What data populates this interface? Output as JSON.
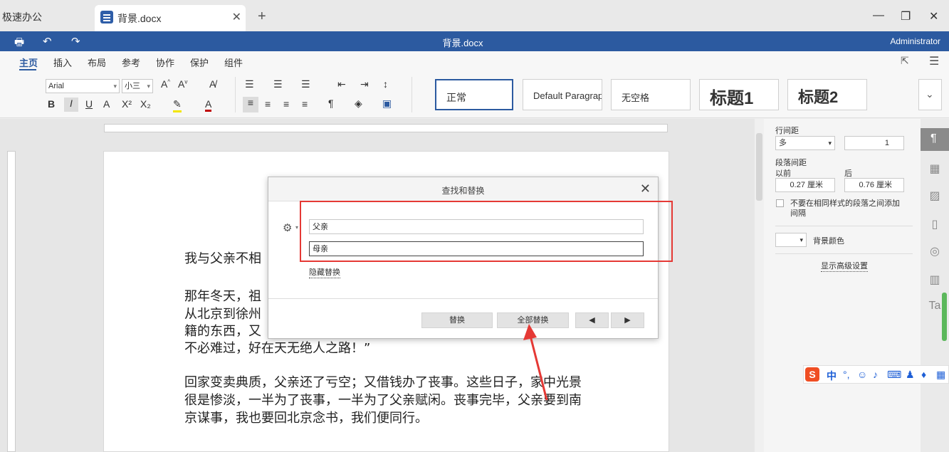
{
  "tabs": {
    "prev_tab": "极速办公",
    "active_tab": "背景.docx",
    "new_tab": "+",
    "close": "✕"
  },
  "window": {
    "minimize": "—",
    "restore": "❐",
    "close": "✕"
  },
  "titlebar": {
    "title": "背景.docx",
    "user": "Administrator"
  },
  "menu": {
    "items": [
      "主页",
      "插入",
      "布局",
      "参考",
      "协作",
      "保护",
      "组件"
    ],
    "active": "主页"
  },
  "toolbar": {
    "font_name": "Arial",
    "font_size": "小三",
    "styles": [
      "正常",
      "Default Paragraph",
      "无空格",
      "标题1",
      "标题2"
    ]
  },
  "document": {
    "paragraphs": [
      "我与父亲不相",
      "那年冬天，祖",
      "从北京到徐州",
      "籍的东西，又",
      "不必难过，好在天无绝人之路！”",
      "回家变卖典质，父亲还了亏空；又借钱办了丧事。这些日子，家中光景",
      "很是惨淡，一半为了丧事，一半为了父亲赋闲。丧事完毕，父亲要到南",
      "京谋事，我也要回北京念书，我们便同行。"
    ]
  },
  "dialog": {
    "title": "查找和替换",
    "find_value": "父亲",
    "replace_value": "母亲",
    "hide_replace": "隐藏替换",
    "replace_btn": "替换",
    "replace_all_btn": "全部替换",
    "prev_btn": "◀",
    "next_btn": "▶"
  },
  "right_panel": {
    "line_spacing_label": "行间距",
    "line_spacing_mode": "多",
    "line_spacing_value": "1",
    "para_spacing_label": "段落间距",
    "before_label": "以前",
    "after_label": "后",
    "before_value": "0.27 厘米",
    "after_value": "0.76 厘米",
    "checkbox_label": "不要在相同样式的段落之间添加间隔",
    "bg_color_label": "背景颜色",
    "advanced_link": "显示高级设置"
  },
  "ime": {
    "logo": "S",
    "mode": "中"
  },
  "colors": {
    "brand": "#2c5aa0",
    "highlight_box": "#e53935",
    "arrow": "#e53935"
  }
}
